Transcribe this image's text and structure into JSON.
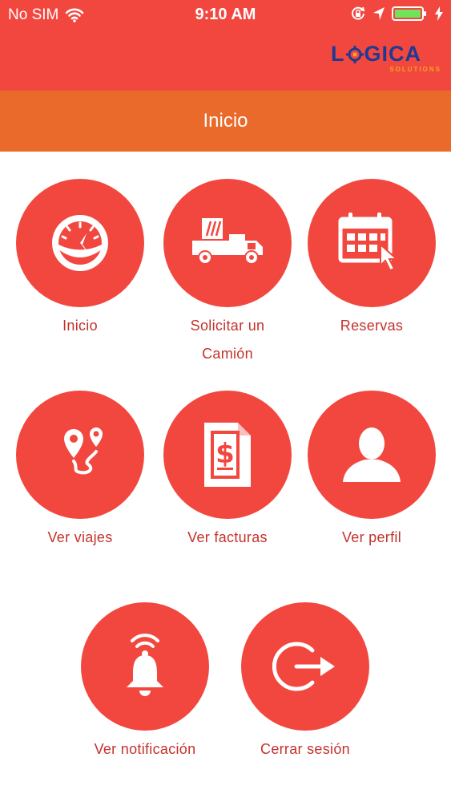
{
  "status_bar": {
    "carrier": "No SIM",
    "time": "9:10 AM"
  },
  "brand": {
    "name_left": "L",
    "name_right": "GICA",
    "sub": "SOLUTIONS"
  },
  "header": {
    "title": "Inicio"
  },
  "menu": [
    {
      "label": "Inicio",
      "icon": "gauge-icon"
    },
    {
      "label": "Solicitar un Camión",
      "icon": "truck-icon"
    },
    {
      "label": "Reservas",
      "icon": "calendar-icon"
    },
    {
      "label": "Ver viajes",
      "icon": "route-icon"
    },
    {
      "label": "Ver facturas",
      "icon": "invoice-icon"
    },
    {
      "label": "Ver perfil",
      "icon": "person-icon"
    },
    {
      "label": "Ver notificación",
      "icon": "bell-icon"
    },
    {
      "label": "Cerrar sesión",
      "icon": "logout-icon"
    }
  ],
  "colors": {
    "primary": "#f2473f",
    "accent": "#e96a2a",
    "label": "#c4322b",
    "logo": "#1f3a93"
  }
}
